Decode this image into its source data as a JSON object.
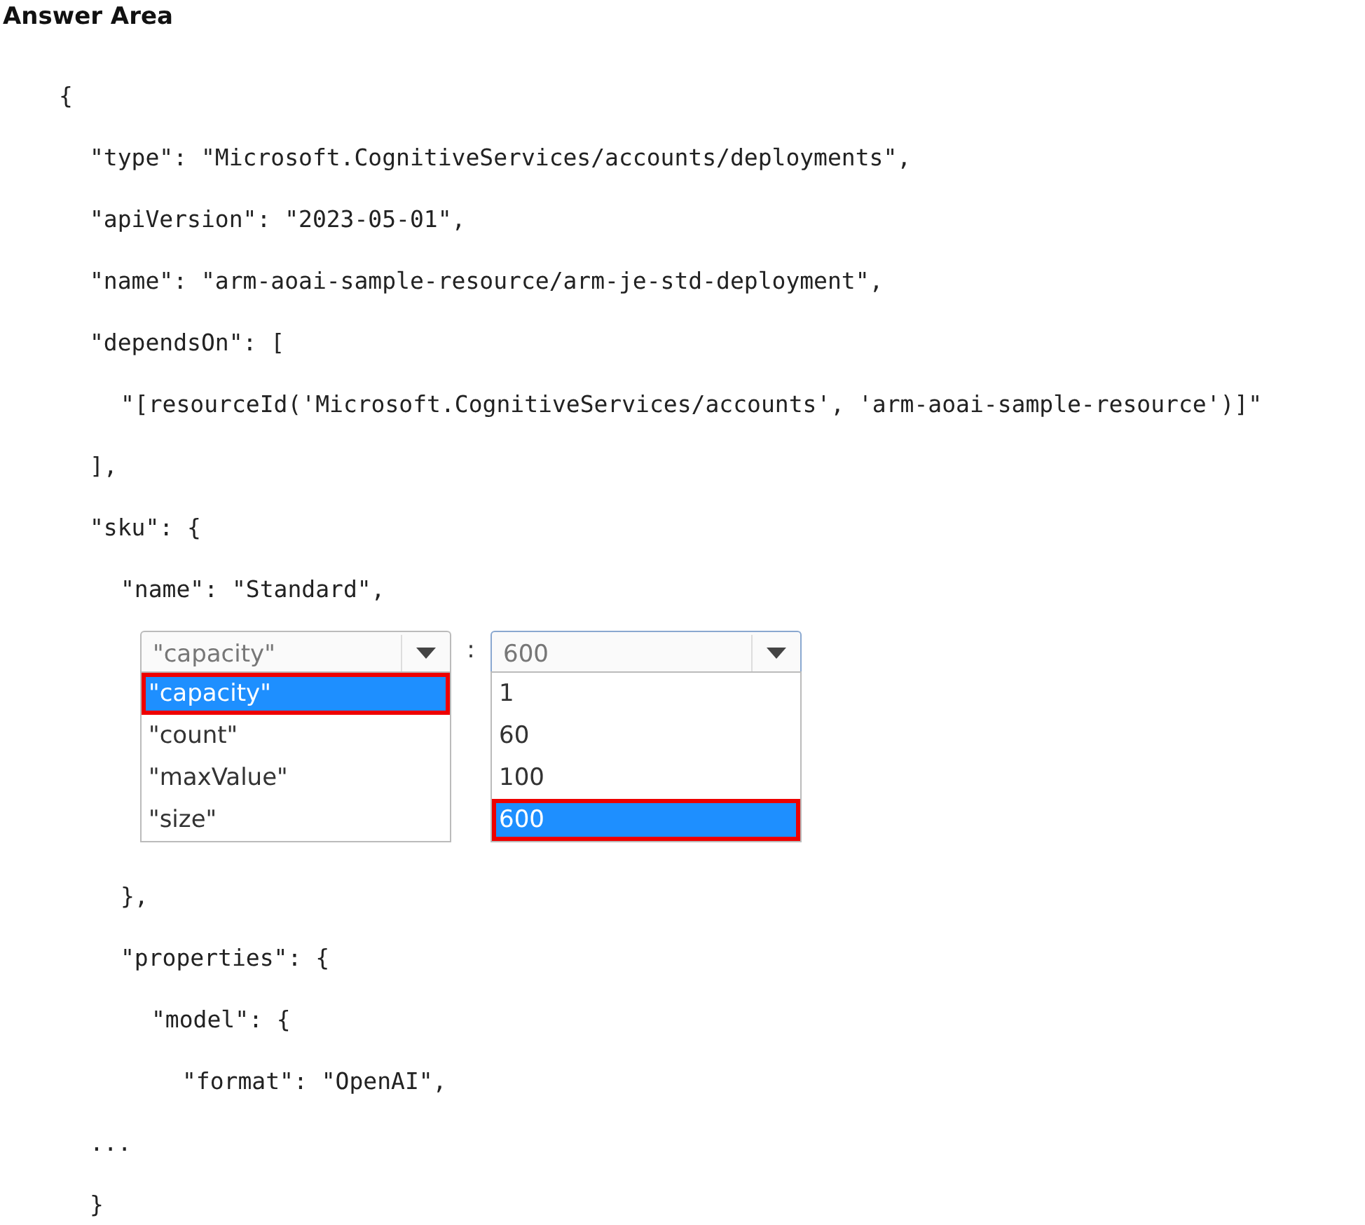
{
  "title": "Answer Area",
  "code": [
    {
      "kind": "code",
      "text": "{",
      "children": [
        {
          "kind": "code",
          "text": "\"type\": \"Microsoft.CognitiveServices/accounts/deployments\","
        },
        {
          "kind": "code",
          "text": "\"apiVersion\": \"2023-05-01\","
        },
        {
          "kind": "code",
          "text": "\"name\": \"arm-aoai-sample-resource/arm-je-std-deployment\","
        },
        {
          "kind": "code",
          "text": "\"dependsOn\": [",
          "children": [
            {
              "kind": "code",
              "text": "\"[resourceId('Microsoft.CognitiveServices/accounts', 'arm-aoai-sample-resource')]\""
            }
          ]
        },
        {
          "kind": "code",
          "text": "],"
        },
        {
          "kind": "code",
          "text": "\"sku\": {",
          "children": [
            {
              "kind": "code",
              "text": "\"name\": \"Standard\","
            },
            {
              "kind": "dropdowns",
              "separator": ":",
              "dropdowns": [
                {
                  "value": "\"capacity\"",
                  "focused": false,
                  "options": [
                    {
                      "label": "\"capacity\"",
                      "selected": true
                    },
                    {
                      "label": "\"count\"",
                      "selected": false
                    },
                    {
                      "label": "\"maxValue\"",
                      "selected": false
                    },
                    {
                      "label": "\"size\"",
                      "selected": false
                    }
                  ]
                },
                {
                  "value": "600",
                  "focused": true,
                  "options": [
                    {
                      "label": "1",
                      "selected": false
                    },
                    {
                      "label": "60",
                      "selected": false
                    },
                    {
                      "label": "100",
                      "selected": false
                    },
                    {
                      "label": "600",
                      "selected": true
                    }
                  ]
                }
              ]
            },
            {
              "kind": "code",
              "text": "},"
            },
            {
              "kind": "code",
              "text": "\"properties\": {",
              "children": [
                {
                  "kind": "code",
                  "text": "\"model\": {",
                  "children": [
                    {
                      "kind": "code",
                      "text": "\"format\": \"OpenAI\","
                    }
                  ]
                }
              ]
            }
          ]
        },
        {
          "kind": "code",
          "text": "..."
        },
        {
          "kind": "code",
          "text": "}"
        }
      ]
    }
  ]
}
